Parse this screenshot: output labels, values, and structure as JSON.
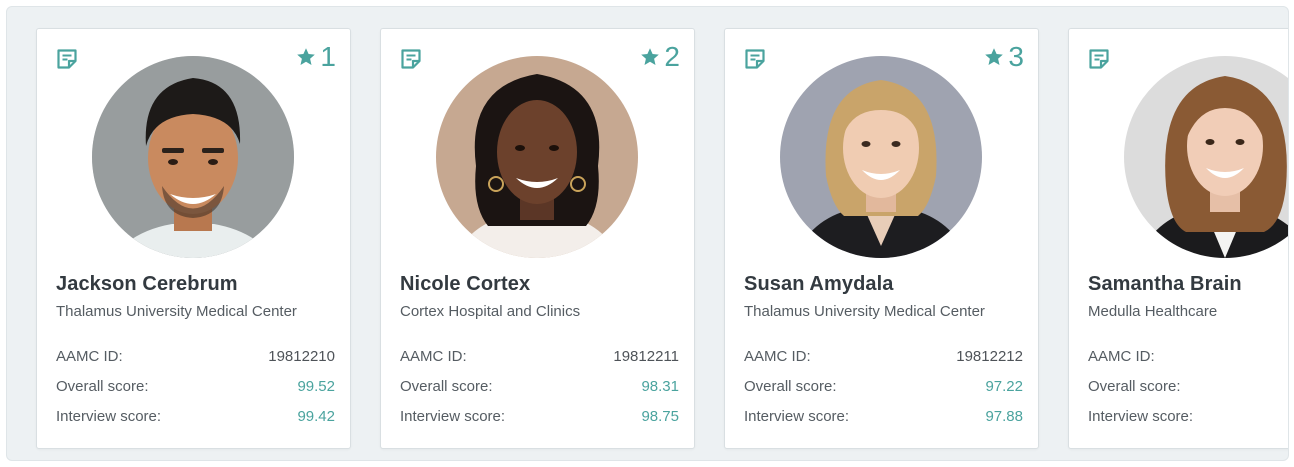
{
  "theme": {
    "accent": "#4aa39e",
    "panel_bg": "#edf1f3",
    "text": "#333a40"
  },
  "labels": {
    "aamc_id": "AAMC ID:",
    "overall": "Overall score:",
    "interview": "Interview score:"
  },
  "icons": {
    "note": "sticky-note-icon",
    "rank": "star-icon"
  },
  "candidates": [
    {
      "rank": "1",
      "name": "Jackson Cerebrum",
      "org": "Thalamus University Medical Center",
      "aamc_id": "19812210",
      "overall": "99.52",
      "interview": "99.42"
    },
    {
      "rank": "2",
      "name": "Nicole Cortex",
      "org": "Cortex Hospital and Clinics",
      "aamc_id": "19812211",
      "overall": "98.31",
      "interview": "98.75"
    },
    {
      "rank": "3",
      "name": "Susan Amydala",
      "org": "Thalamus University Medical Center",
      "aamc_id": "19812212",
      "overall": "97.22",
      "interview": "97.88"
    },
    {
      "rank": "",
      "name": "Samantha Brain",
      "org": "Medulla Healthcare",
      "aamc_id": "",
      "overall": "",
      "interview": ""
    }
  ]
}
